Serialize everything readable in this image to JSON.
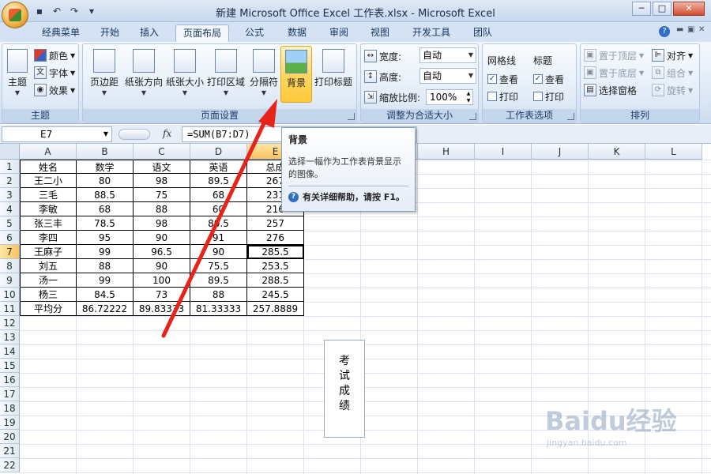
{
  "window": {
    "title": "新建 Microsoft Office Excel 工作表.xlsx - Microsoft Excel",
    "controls": [
      "─",
      "□",
      "✕"
    ]
  },
  "quick_access": [
    "save-icon",
    "undo-icon",
    "redo-icon",
    "customize-icon"
  ],
  "tabs": [
    "经典菜单",
    "开始",
    "插入",
    "页面布局",
    "公式",
    "数据",
    "审阅",
    "视图",
    "开发工具",
    "团队"
  ],
  "active_tab": "页面布局",
  "ribbon": {
    "theme_group": {
      "label": "主题",
      "theme_button": "主题",
      "colors": "颜色",
      "fonts": "字体",
      "effects": "效果"
    },
    "page_setup_group": {
      "label": "页面设置",
      "margins": "页边距",
      "orientation": "纸张方向",
      "size": "纸张大小",
      "print_area": "打印区域",
      "breaks": "分隔符",
      "background": "背景",
      "print_titles": "打印标题"
    },
    "scale_group": {
      "label": "调整为合适大小",
      "width_label": "宽度:",
      "width_value": "自动",
      "height_label": "高度:",
      "height_value": "自动",
      "scale_label": "缩放比例:",
      "scale_value": "100%"
    },
    "sheet_options_group": {
      "label": "工作表选项",
      "gridlines": "网格线",
      "headings": "标题",
      "view": "查看",
      "print": "打印",
      "gridlines_view_checked": true,
      "headings_view_checked": true
    },
    "arrange_group": {
      "label": "排列",
      "bring_forward": "置于顶层",
      "send_backward": "置于底层",
      "selection_pane": "选择窗格",
      "align": "对齐",
      "group": "组合",
      "rotate": "旋转"
    }
  },
  "formula_bar": {
    "name_box": "E7",
    "fx": "fx",
    "formula": "=SUM(B7:D7)"
  },
  "columns": [
    "A",
    "B",
    "C",
    "D",
    "E",
    "F",
    "G",
    "H",
    "I",
    "J",
    "K",
    "L"
  ],
  "selected_column": "E",
  "rows": [
    "1",
    "2",
    "3",
    "4",
    "5",
    "6",
    "7",
    "8",
    "9",
    "10",
    "11",
    "12",
    "13",
    "14",
    "15",
    "16",
    "17",
    "18",
    "19",
    "20",
    "21",
    "22"
  ],
  "selected_row": "7",
  "table": [
    [
      "姓名",
      "数学",
      "语文",
      "英语",
      "总成"
    ],
    [
      "王二小",
      "80",
      "98",
      "89.5",
      "267"
    ],
    [
      "三毛",
      "88.5",
      "75",
      "68",
      "231"
    ],
    [
      "李敏",
      "68",
      "88",
      "60",
      "216"
    ],
    [
      "张三丰",
      "78.5",
      "98",
      "80.5",
      "257"
    ],
    [
      "李四",
      "95",
      "90",
      "91",
      "276"
    ],
    [
      "王麻子",
      "99",
      "96.5",
      "90",
      "285.5"
    ],
    [
      "刘五",
      "88",
      "90",
      "75.5",
      "253.5"
    ],
    [
      "汤一",
      "99",
      "100",
      "89.5",
      "288.5"
    ],
    [
      "杨三",
      "84.5",
      "73",
      "88",
      "245.5"
    ],
    [
      "平均分",
      "86.72222",
      "89.83333",
      "81.33333",
      "257.8889"
    ]
  ],
  "textbox_chars": [
    "考",
    "试",
    "成",
    "绩"
  ],
  "tooltip": {
    "title": "背景",
    "body": "选择一幅作为工作表背景显示的图像。",
    "help": "有关详细帮助，请按 F1。"
  },
  "watermark": {
    "main": "Baidu经验",
    "sub": "jingyan.baidu.com"
  },
  "colors": {
    "accent": "#ffc839",
    "arrow": "#e8231a",
    "ribbon": "#dbe7f5"
  }
}
